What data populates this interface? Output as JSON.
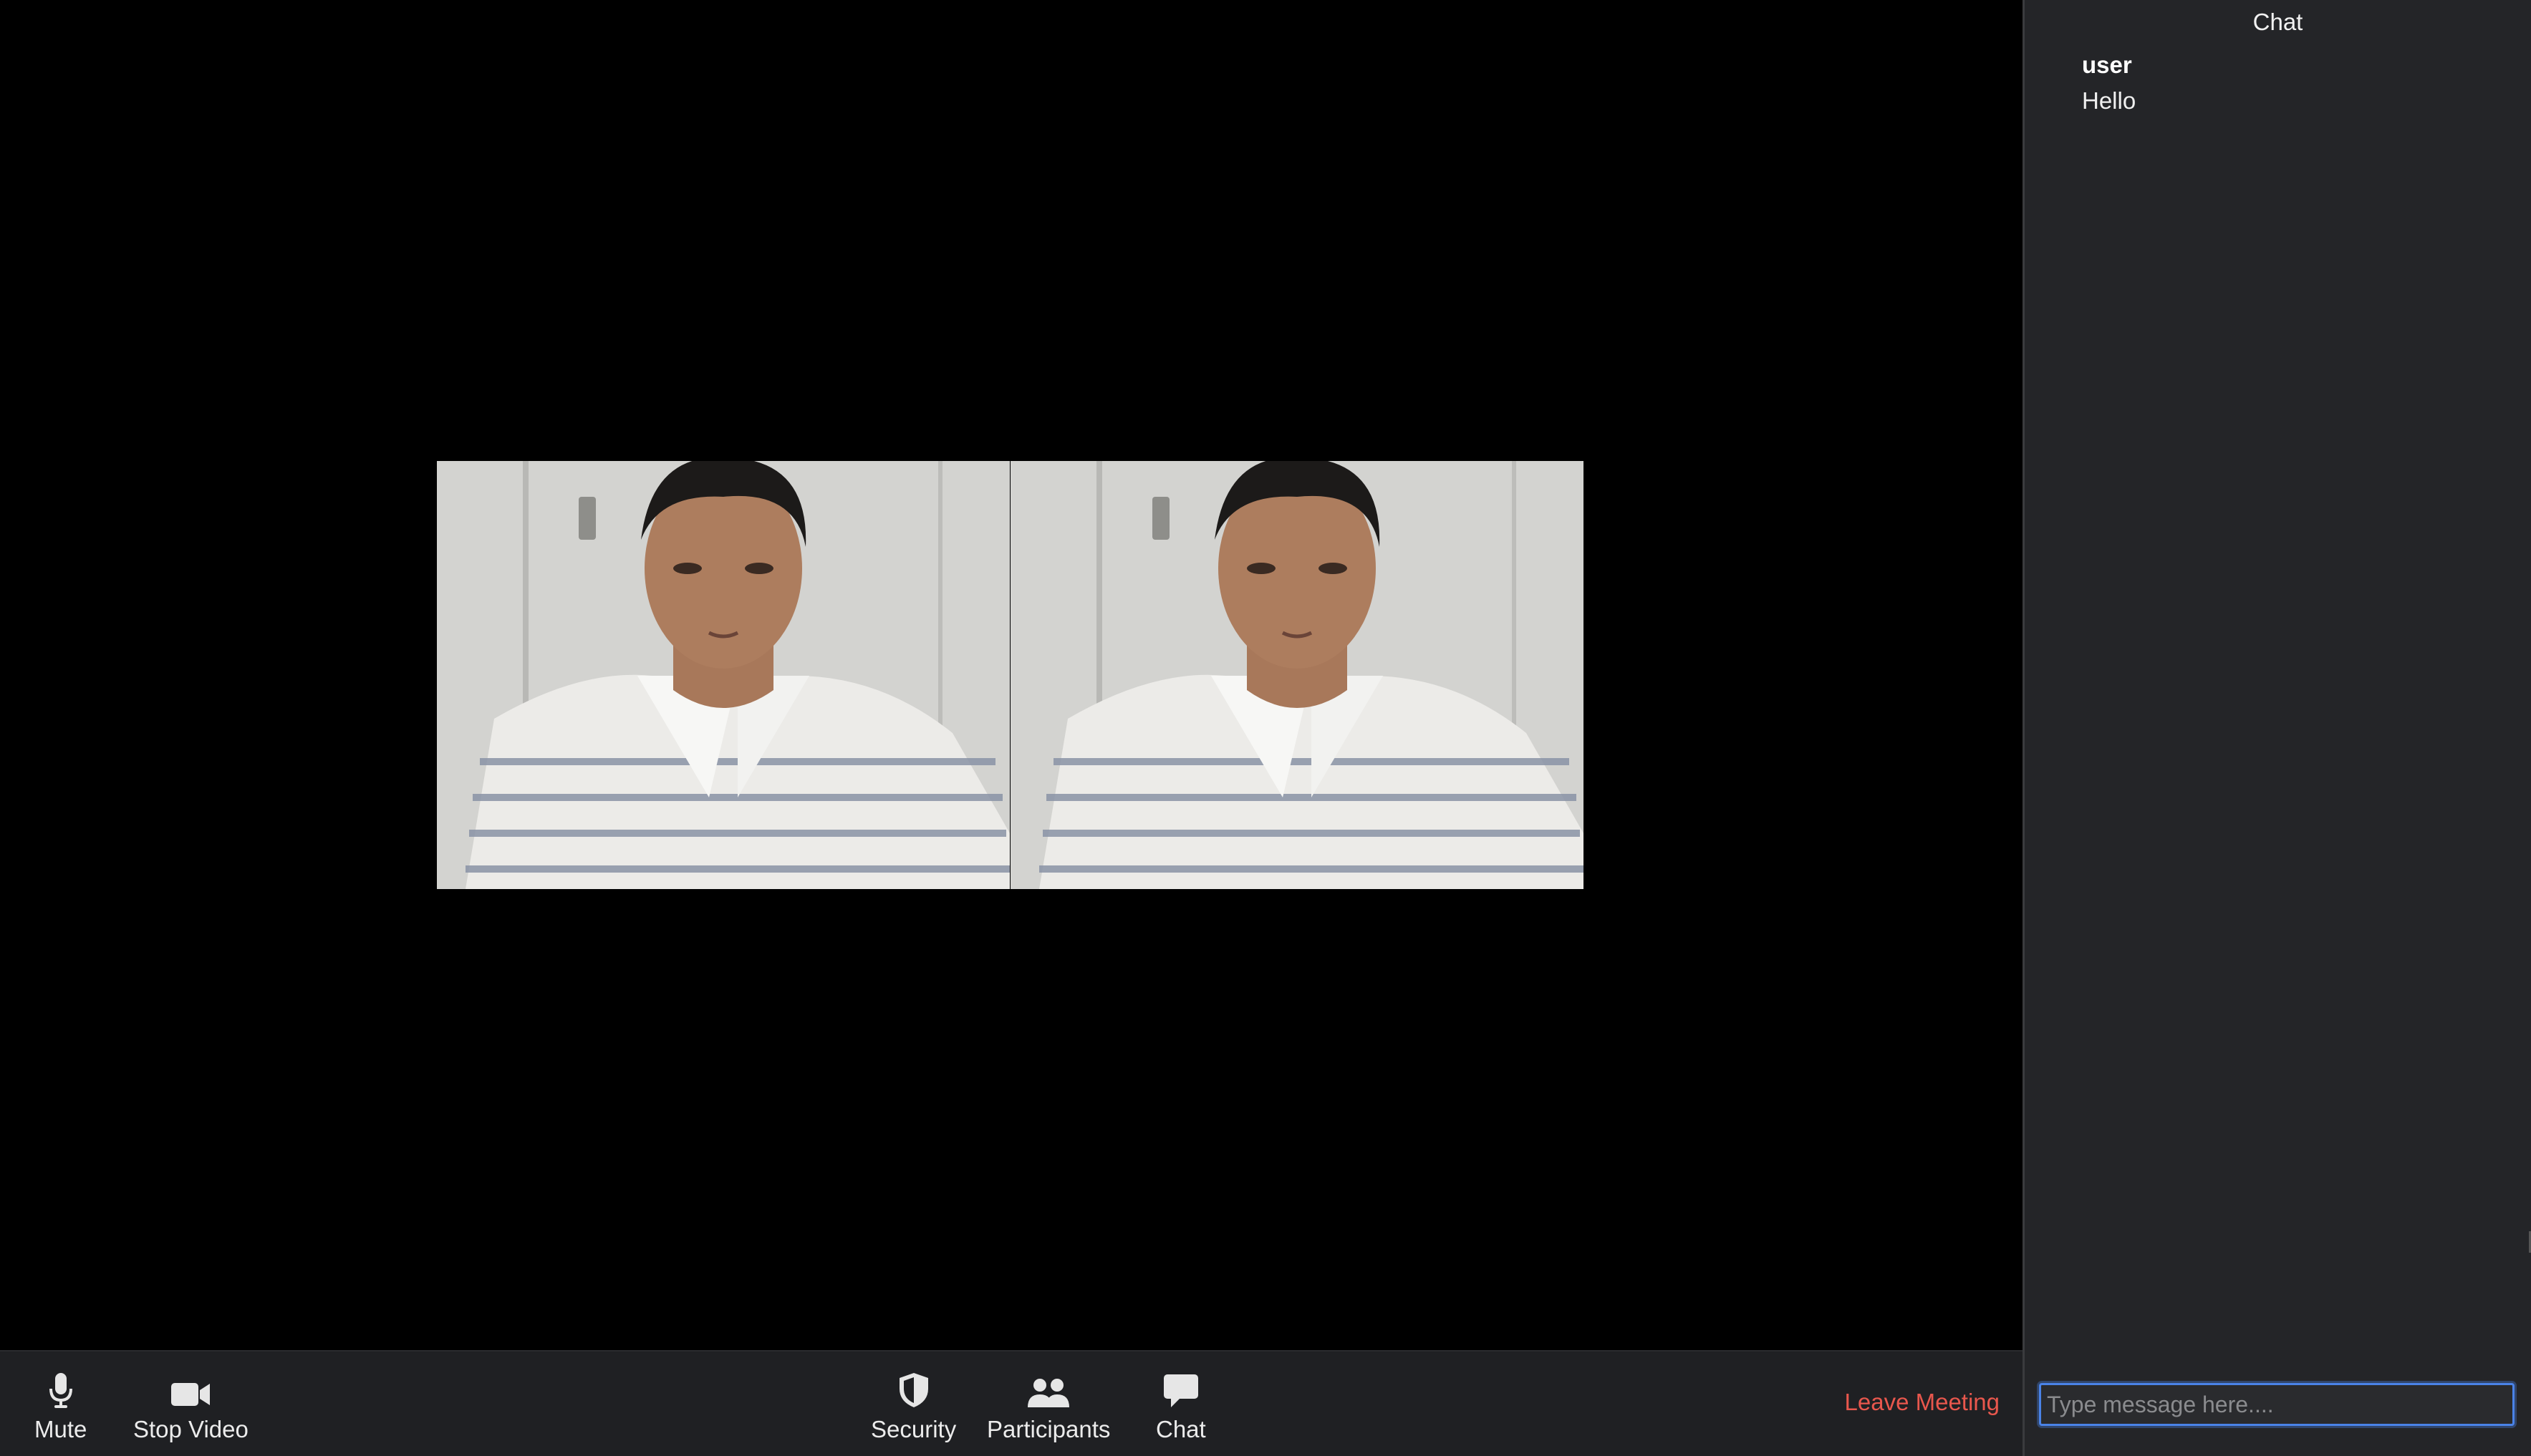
{
  "toolbar": {
    "mute_label": "Mute",
    "stop_video_label": "Stop Video",
    "security_label": "Security",
    "participants_label": "Participants",
    "chat_label": "Chat",
    "leave_label": "Leave Meeting"
  },
  "chat": {
    "title": "Chat",
    "messages": [
      {
        "sender": "user",
        "text": "Hello"
      }
    ],
    "input_placeholder": "Type message here...."
  },
  "colors": {
    "leave": "#e8574d",
    "input_focus": "#4a83e8",
    "panel_bg": "#242528",
    "toolbar_bg": "#1f2023"
  }
}
